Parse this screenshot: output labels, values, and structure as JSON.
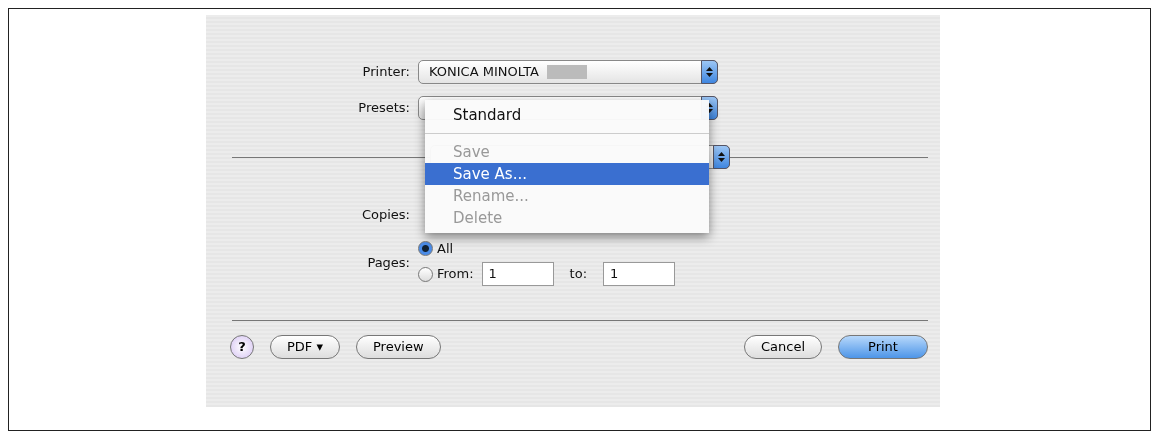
{
  "printer": {
    "label": "Printer:",
    "value": "KONICA MINOLTA",
    "redacted": true
  },
  "presets": {
    "label": "Presets:"
  },
  "presets_menu": [
    {
      "kind": "item",
      "label": "Standard",
      "disabled": false,
      "selected": false
    },
    {
      "kind": "separator"
    },
    {
      "kind": "item",
      "label": "Save",
      "disabled": true,
      "selected": false
    },
    {
      "kind": "item",
      "label": "Save As...",
      "disabled": false,
      "selected": true
    },
    {
      "kind": "item",
      "label": "Rename...",
      "disabled": true,
      "selected": false
    },
    {
      "kind": "item",
      "label": "Delete",
      "disabled": true,
      "selected": false
    }
  ],
  "copies": {
    "label": "Copies:"
  },
  "pages": {
    "label": "Pages:",
    "options": [
      {
        "label": "All",
        "selected": true
      },
      {
        "label": "From:",
        "selected": false
      }
    ],
    "from": "1",
    "to_label": "to:",
    "to": "1"
  },
  "buttons": {
    "help": "?",
    "pdf": "PDF ▾",
    "preview": "Preview",
    "cancel": "Cancel",
    "print": "Print"
  }
}
